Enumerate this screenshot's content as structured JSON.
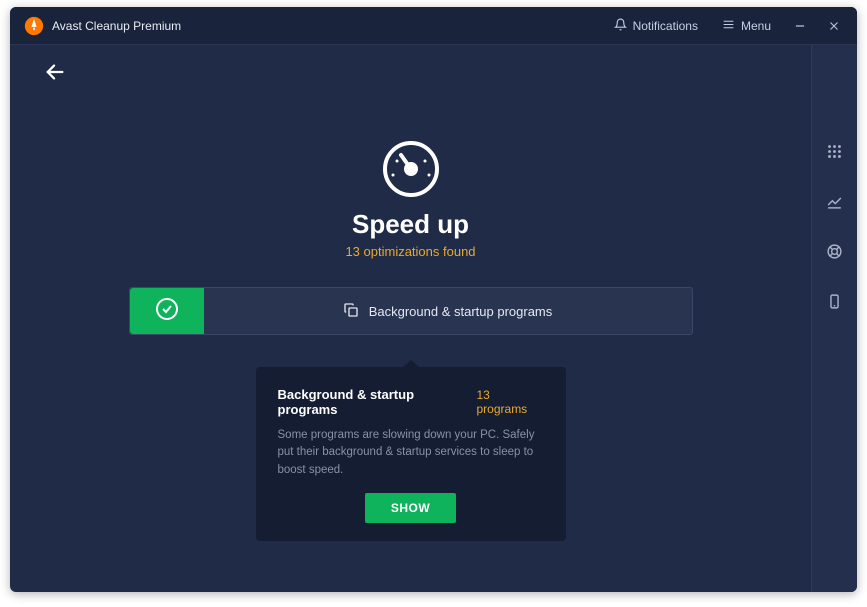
{
  "titlebar": {
    "app_name": "Avast Cleanup Premium",
    "notifications_label": "Notifications",
    "menu_label": "Menu"
  },
  "hero": {
    "title": "Speed up",
    "subtitle": "13 optimizations found"
  },
  "optimization_bar": {
    "label": "Background & startup programs"
  },
  "popup": {
    "title": "Background & startup programs",
    "count": "13 programs",
    "description": "Some programs are slowing down your PC. Safely put their background & startup services to sleep to boost speed.",
    "button_label": "SHOW"
  },
  "colors": {
    "accent": "#e9a92e",
    "success": "#0eb35b",
    "bg_main": "#1f2b47",
    "bg_dark": "#141d32"
  }
}
